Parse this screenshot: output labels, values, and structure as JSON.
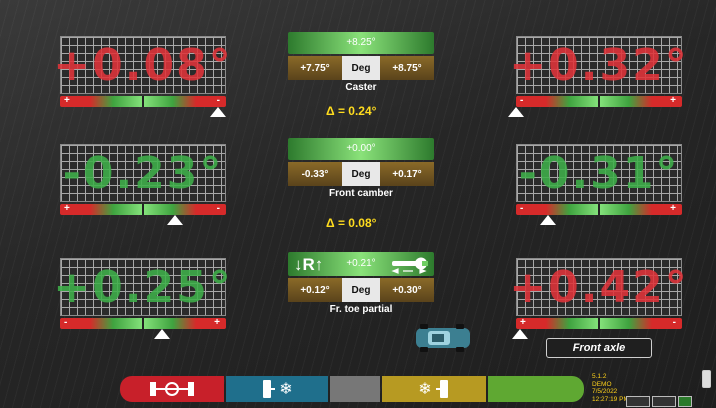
{
  "readings": {
    "left_caster": "+0.08°",
    "right_caster": "+0.32°",
    "left_camber": "-0.23°",
    "right_camber": "-0.31°",
    "left_toe": "+0.25°",
    "right_toe": "+0.42°"
  },
  "caster": {
    "target": "+8.25°",
    "min": "+7.75°",
    "unit": "Deg",
    "max": "+8.75°",
    "name": "Caster",
    "delta": "Δ = 0.24°"
  },
  "camber": {
    "target": "+0.00°",
    "min": "-0.33°",
    "unit": "Deg",
    "max": "+0.17°",
    "name": "Front camber",
    "delta": "Δ = 0.08°"
  },
  "toe": {
    "target": "+0.21°",
    "min": "+0.12°",
    "unit": "Deg",
    "max": "+0.30°",
    "name": "Fr. toe partial",
    "icon": "↓R↑"
  },
  "bar_signs": {
    "plus": "+",
    "minus": "-"
  },
  "axle_label": "Front axle",
  "version": {
    "number": "5.1.2",
    "mode": "DEMO",
    "date": "7/5/2022",
    "time": "12:27:19 PM"
  },
  "icons": {
    "snowflake": "❄"
  },
  "colors": {
    "out_of_spec": "#e0343a",
    "in_spec": "#3fb04a",
    "toolbar_red": "#c8202a",
    "toolbar_blue": "#1f6f8c",
    "toolbar_gray": "#777777",
    "toolbar_yellow": "#b79a22",
    "toolbar_green": "#5fa832"
  }
}
